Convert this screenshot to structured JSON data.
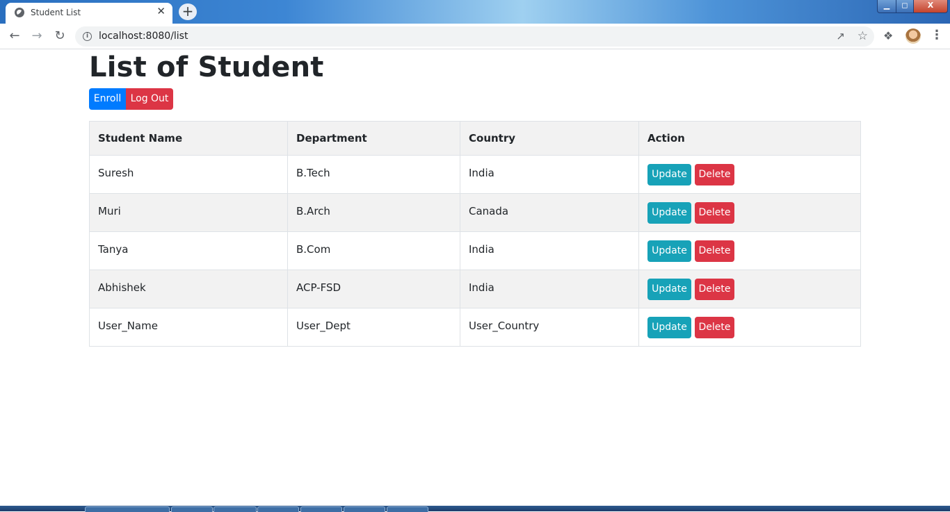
{
  "browser": {
    "tab_title": "Student List",
    "tab_close": "✕",
    "new_tab": "+",
    "url": "localhost:8080/list",
    "window_controls": {
      "minimize": "▁",
      "maximize": "◻",
      "close": "X"
    }
  },
  "page": {
    "title": "List of Student",
    "enroll_label": "Enroll",
    "logout_label": "Log Out"
  },
  "table": {
    "headers": [
      "Student Name",
      "Department",
      "Country",
      "Action"
    ],
    "rows": [
      {
        "name": "Suresh",
        "department": "B.Tech",
        "country": "India"
      },
      {
        "name": "Muri",
        "department": "B.Arch",
        "country": "Canada"
      },
      {
        "name": "Tanya",
        "department": "B.Com",
        "country": "India"
      },
      {
        "name": "Abhishek",
        "department": "ACP-FSD",
        "country": "India"
      },
      {
        "name": "User_Name",
        "department": "User_Dept",
        "country": "User_Country"
      }
    ],
    "update_label": "Update",
    "delete_label": "Delete"
  },
  "colors": {
    "enroll": "#007bff",
    "danger": "#dc3545",
    "update": "#17a2b8"
  }
}
